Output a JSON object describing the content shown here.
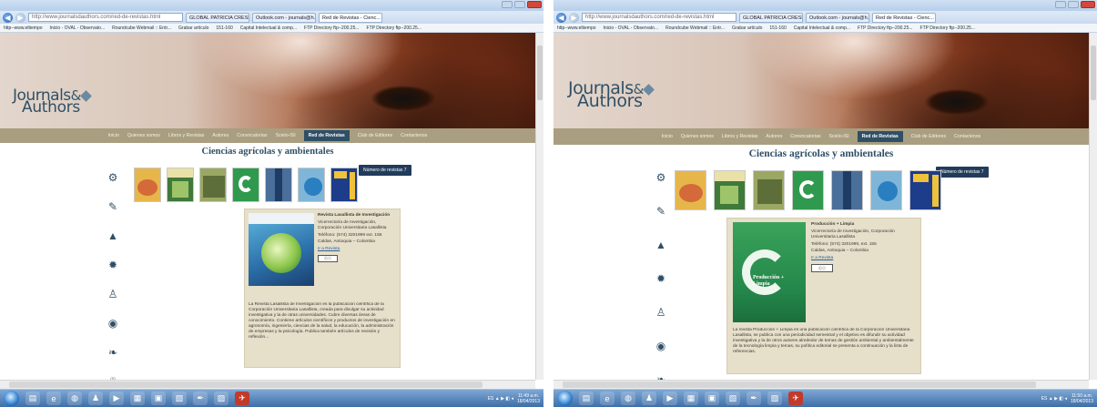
{
  "screens": [
    {
      "id": "left",
      "browser": {
        "url": "http://www.journalsdauthors.com/red-de-revistas.html",
        "tabs": [
          "GLOBAL PATRICIA CRESPO",
          "Outlook.com - journals@h...",
          "Red de Revistas - Cienc..."
        ],
        "bookmarks": [
          "http--www.eltiempo",
          "Inicio - OVAL - Observato...",
          "Roundcube Webmail :: Entr...",
          "Grabar artículo",
          "151-160",
          "Capital Intelectual & comp...",
          "FTP Directory ftp--200.25...",
          "FTP Directory ftp--200.25..."
        ]
      },
      "site": {
        "logo_line1": "Journals",
        "logo_amp": "&",
        "logo_line2": "Authors",
        "menu": [
          "Inicio",
          "Quienes somos",
          "Libros y Revistas",
          "Autores",
          "Convocatorias",
          "Scielo-ISI",
          "Red de Revistas",
          "Club de Editores",
          "Contactenos"
        ],
        "active_menu": "Red de Revistas",
        "section_title": "Ciencias agrícolas y ambientales",
        "count_button": "Número de revistas 7",
        "detail": {
          "name": "Revista Lasallista de Investigación",
          "publisher": "Vicerrectoría de Investigación, Corporación Universitaria Lasallista",
          "address": "Teléfono: (574) 3201999 ext. 155",
          "city": "Caldas, Antioquia – Colombia",
          "link": "Ir a Revista",
          "description": "La Revista Lasallista de Investigación es la publicación científica de la Corporación Universitaria Lasallista, creada para divulgar su actividad investigativa y la de otras universidades. Cubre diversas áreas de conocimiento. Contiene artículos científicos y productos de investigación en agronomía, ingeniería, ciencias de la salud, la educación, la administración de empresas y la psicología. Publica también artículos de revisión y reflexión..."
        }
      }
    },
    {
      "id": "right",
      "browser": {
        "url": "http://www.journalsdauthors.com/red-de-revistas.html",
        "tabs": [
          "GLOBAL PATRICIA CRESPO",
          "Outlook.com - journals@h...",
          "Red de Revistas - Cienc..."
        ],
        "bookmarks": [
          "http--www.eltiempo",
          "Inicio - OVAL - Observato...",
          "Roundcube Webmail :: Entr...",
          "Grabar artículo",
          "151-160",
          "Capital Intelectual & comp...",
          "FTP Directory ftp--200.25...",
          "FTP Directory ftp--200.25..."
        ]
      },
      "site": {
        "logo_line1": "Journals",
        "logo_amp": "&",
        "logo_line2": "Authors",
        "menu": [
          "Inicio",
          "Quienes somos",
          "Libros y Revistas",
          "Autores",
          "Convocatorias",
          "Scielo-ISI",
          "Red de Revistas",
          "Club de Editores",
          "Contactenos"
        ],
        "active_menu": "Red de Revistas",
        "section_title": "Ciencias agrícolas y ambientales",
        "count_button": "Número de revistas 7",
        "detail": {
          "name": "Producción + Limpia",
          "publisher": "Vicerrectoría de Investigación, Corporación Universitaria Lasallista",
          "address": "Teléfono: (574) 3201999, ext. 155",
          "city": "Caldas, Antioquia – Colombia",
          "link": "Ir a Revista",
          "cover_title": "Producción + Limpia",
          "description": "La revista Producción + Limpia es una publicación científica de la Corporación Universitaria Lasallista, se publica con una periodicidad semestral y el objetivo es difundir su actividad investigativa y la de otros autores alrededor de temas de gestión ambiental y ambientalmente de la tecnología limpia y temas, su política editorial se presenta a continuación y la lista de referencias."
        }
      }
    }
  ],
  "taskbar": {
    "left_clock_time": "11:49 a.m.",
    "left_clock_date": "18/04/2013",
    "right_clock_time": "11:50 a.m.",
    "right_clock_date": "18/04/2013"
  },
  "colors": {
    "brand_blue": "#2f4f66",
    "menu_bar": "#a99e80",
    "active_menu": "#2f4f66",
    "panel_bg": "#e6dfc9",
    "count_button": "#213c5b"
  },
  "icons": [
    "bicycle-icon",
    "leaf-drop-icon",
    "landscape-icon",
    "gear-icon",
    "flask-icon",
    "globe-icon",
    "fish-icon",
    "recycle-icon"
  ]
}
